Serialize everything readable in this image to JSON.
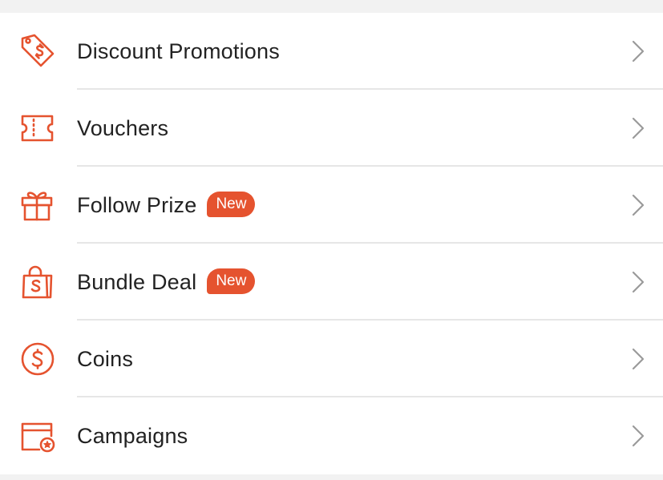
{
  "colors": {
    "accent": "#e5532f",
    "text": "#222222",
    "chevron": "#9a9a9a",
    "divider": "#e6e6e6",
    "background": "#f2f2f2"
  },
  "menu": {
    "items": [
      {
        "label": "Discount Promotions",
        "icon": "price-tag-icon",
        "badge": ""
      },
      {
        "label": "Vouchers",
        "icon": "voucher-ticket-icon",
        "badge": ""
      },
      {
        "label": "Follow Prize",
        "icon": "gift-icon",
        "badge": "New"
      },
      {
        "label": "Bundle Deal",
        "icon": "shopping-bag-icon",
        "badge": "New"
      },
      {
        "label": "Coins",
        "icon": "coin-icon",
        "badge": ""
      },
      {
        "label": "Campaigns",
        "icon": "campaign-calendar-icon",
        "badge": ""
      }
    ]
  }
}
